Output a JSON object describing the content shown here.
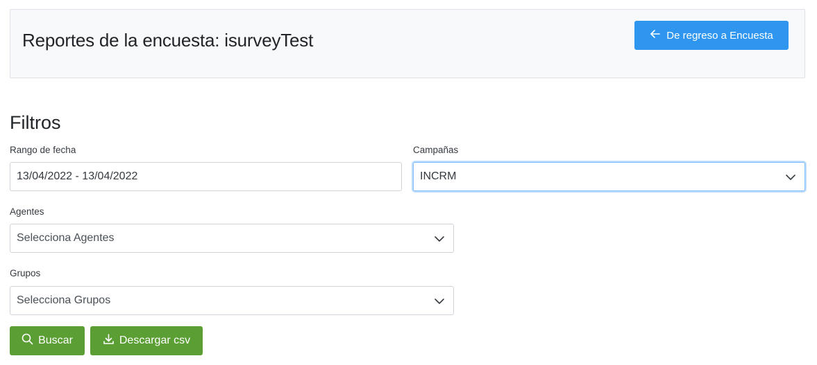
{
  "header": {
    "title": "Reportes de la encuesta: isurveyTest",
    "back_button_label": "De regreso a Encuesta"
  },
  "filters": {
    "section_title": "Filtros",
    "date_range": {
      "label": "Rango de fecha",
      "value": "13/04/2022 - 13/04/2022"
    },
    "campaigns": {
      "label": "Campañas",
      "value": "INCRM"
    },
    "agents": {
      "label": "Agentes",
      "value": "Selecciona Agentes"
    },
    "groups": {
      "label": "Grupos",
      "value": "Selecciona Grupos"
    }
  },
  "actions": {
    "search_label": "Buscar",
    "download_label": "Descargar csv"
  },
  "icons": {
    "back": "arrow-left-icon",
    "dropdown": "chevron-down-icon",
    "search": "search-icon",
    "download": "download-icon"
  },
  "colors": {
    "primary": "#2f96f0",
    "success": "#5a9e34",
    "header_bg": "#f8f9fa"
  }
}
